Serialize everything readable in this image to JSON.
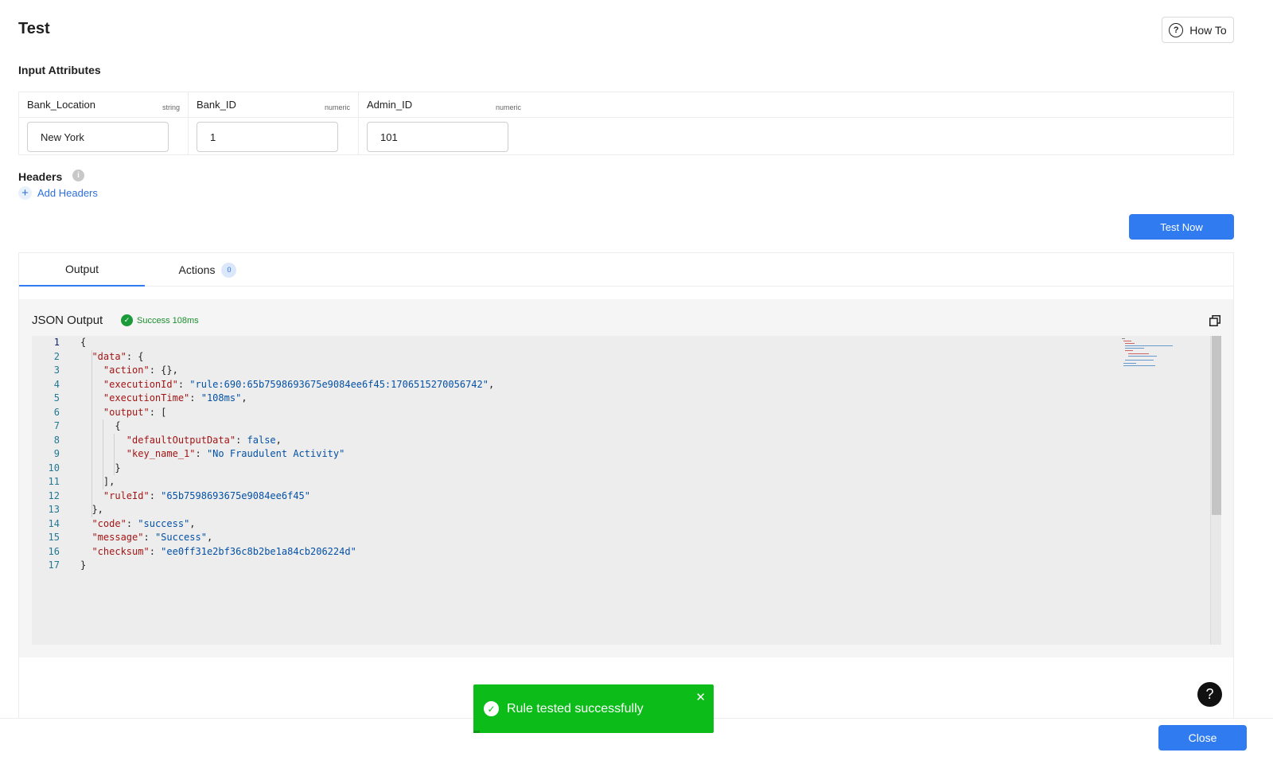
{
  "page": {
    "title": "Test",
    "how_to_label": "How To"
  },
  "input_attributes": {
    "label": "Input Attributes",
    "columns": [
      {
        "name": "Bank_Location",
        "type": "string",
        "value": "New York"
      },
      {
        "name": "Bank_ID",
        "type": "numeric",
        "value": "1"
      },
      {
        "name": "Admin_ID",
        "type": "numeric",
        "value": "101"
      }
    ]
  },
  "headers": {
    "label": "Headers",
    "add_label": "Add Headers"
  },
  "test_now_label": "Test Now",
  "tabs": [
    {
      "label": "Output",
      "active": true
    },
    {
      "label": "Actions",
      "badge": "0",
      "active": false
    }
  ],
  "output": {
    "title": "JSON Output",
    "status": "Success 108ms",
    "lines": [
      {
        "n": "1",
        "text": "{"
      },
      {
        "n": "2",
        "text": "  \"data\": {"
      },
      {
        "n": "3",
        "text": "    \"action\": {},"
      },
      {
        "n": "4",
        "text": "    \"executionId\": \"rule:690:65b7598693675e9084ee6f45:1706515270056742\","
      },
      {
        "n": "5",
        "text": "    \"executionTime\": \"108ms\","
      },
      {
        "n": "6",
        "text": "    \"output\": ["
      },
      {
        "n": "7",
        "text": "      {"
      },
      {
        "n": "8",
        "text": "        \"defaultOutputData\": false,"
      },
      {
        "n": "9",
        "text": "        \"key_name_1\": \"No Fraudulent Activity\""
      },
      {
        "n": "10",
        "text": "      }"
      },
      {
        "n": "11",
        "text": "    ],"
      },
      {
        "n": "12",
        "text": "    \"ruleId\": \"65b7598693675e9084ee6f45\""
      },
      {
        "n": "13",
        "text": "  },"
      },
      {
        "n": "14",
        "text": "  \"code\": \"success\","
      },
      {
        "n": "15",
        "text": "  \"message\": \"Success\","
      },
      {
        "n": "16",
        "text": "  \"checksum\": \"ee0ff31e2bf36c8b2be1a84cb206224d\""
      },
      {
        "n": "17",
        "text": "}"
      }
    ]
  },
  "toast": {
    "message": "Rule tested successfully"
  },
  "close_label": "Close",
  "help_label": "?",
  "colors": {
    "primary": "#2f7bef",
    "success": "#1a9a38",
    "toast_bg": "#0cbd1a"
  }
}
